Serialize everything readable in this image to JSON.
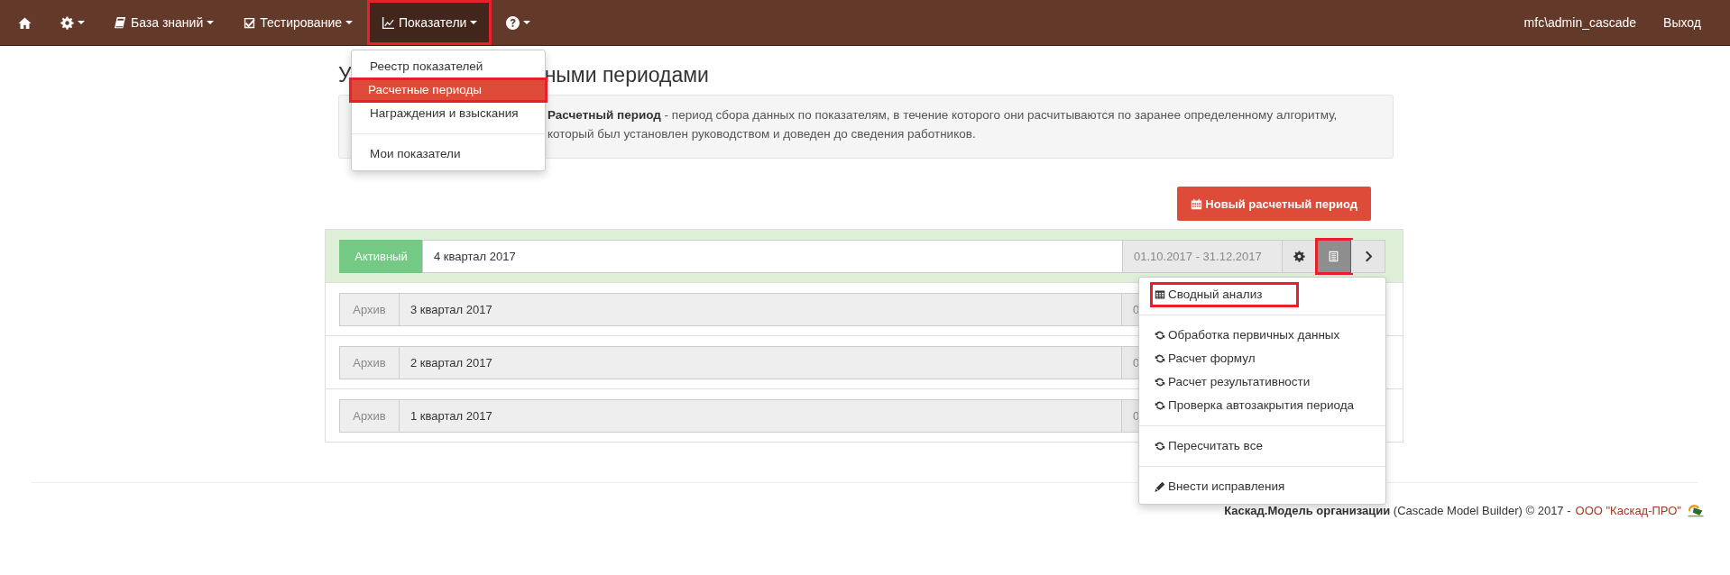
{
  "navbar": {
    "items": [
      {
        "kind": "home",
        "caret": false,
        "selected": false,
        "highlighted": false
      },
      {
        "kind": "settings",
        "caret": true,
        "selected": false,
        "highlighted": false
      },
      {
        "kind": "book",
        "label": "База знаний",
        "caret": true,
        "selected": false,
        "highlighted": false
      },
      {
        "kind": "check",
        "label": "Тестирование",
        "caret": true,
        "selected": false,
        "highlighted": false
      },
      {
        "kind": "chart",
        "label": "Показатели",
        "caret": true,
        "selected": true,
        "highlighted": true
      },
      {
        "kind": "help",
        "caret": true,
        "selected": false,
        "highlighted": false
      }
    ],
    "user": "mfc\\admin_cascade",
    "logout": "Выход"
  },
  "nav_menu": {
    "items": [
      {
        "kind": "link",
        "label": "Реестр показателей",
        "selected": false,
        "highlighted": false
      },
      {
        "kind": "link",
        "label": "Расчетные периоды",
        "selected": true,
        "highlighted": true
      },
      {
        "kind": "link",
        "label": "Награждения и взыскания",
        "selected": false,
        "highlighted": false
      },
      {
        "kind": "divider"
      },
      {
        "kind": "link",
        "label": "Мои показатели",
        "selected": false,
        "highlighted": false
      }
    ]
  },
  "page_title": {
    "visible_start": "У",
    "visible_end": "ными периодами"
  },
  "info": "**Расчетный период** - период сбора данных по показателям, в течение которого они расчитываются по заранее определенному алгоритму, который был установлен руководством и доведен до сведения работников.",
  "new_period_button": "Новый расчетный период",
  "periods": [
    {
      "kind": "active",
      "status": "Активный",
      "name": "4 квартал 2017",
      "dates": "01.10.2017 - 31.12.2017",
      "actions": [
        {
          "kind": "settings",
          "pressed": false,
          "highlighted": false
        },
        {
          "kind": "summary",
          "pressed": true,
          "highlighted": true
        },
        {
          "kind": "next",
          "pressed": false,
          "highlighted": false
        }
      ]
    },
    {
      "kind": "archive",
      "status": "Архив",
      "name": "3 квартал 2017",
      "dates": "0"
    },
    {
      "kind": "archive",
      "status": "Архив",
      "name": "2 квартал 2017",
      "dates": "0"
    },
    {
      "kind": "archive",
      "status": "Архив",
      "name": "1 квартал 2017",
      "dates": "0"
    }
  ],
  "action_menu": {
    "items": [
      {
        "kind": "table",
        "label": "Сводный анализ",
        "highlighted": true
      },
      {
        "kind": "divider"
      },
      {
        "kind": "refresh",
        "label": "Обработка первичных данных",
        "highlighted": false
      },
      {
        "kind": "refresh",
        "label": "Расчет формул",
        "highlighted": false
      },
      {
        "kind": "refresh",
        "label": "Расчет результативности",
        "highlighted": false
      },
      {
        "kind": "refresh",
        "label": "Проверка автозакрытия периода",
        "highlighted": false
      },
      {
        "kind": "divider"
      },
      {
        "kind": "refresh",
        "label": "Пересчитать все",
        "highlighted": false
      },
      {
        "kind": "divider"
      },
      {
        "kind": "pencil",
        "label": "Внести исправления",
        "highlighted": false
      }
    ]
  },
  "footer": {
    "text": "**Каскад.Модель организации** (Cascade Model Builder) © 2017 -",
    "link": "ООО \"Каскад-ПРО\""
  }
}
